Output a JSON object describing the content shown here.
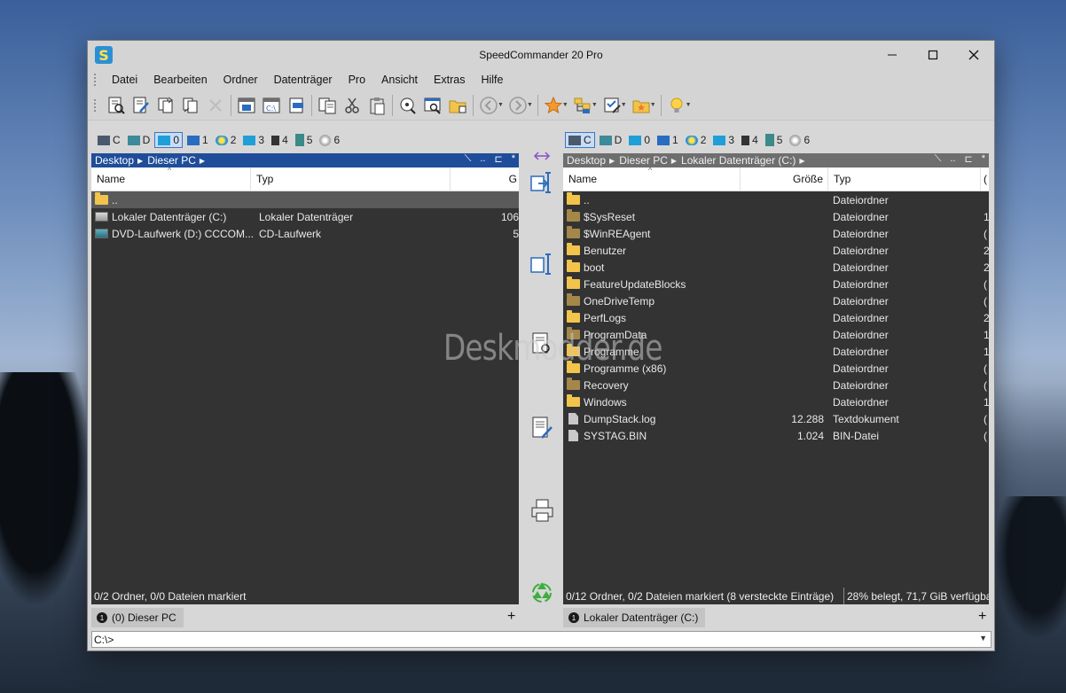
{
  "window": {
    "title": "SpeedCommander 20 Pro",
    "controls": {
      "minimize": "—",
      "maximize": "☐",
      "close": "✕"
    }
  },
  "menu": [
    "Datei",
    "Bearbeiten",
    "Ordner",
    "Datenträger",
    "Pro",
    "Ansicht",
    "Extras",
    "Hilfe"
  ],
  "drives": [
    {
      "label": "C",
      "icon": "computer-icon"
    },
    {
      "label": "D",
      "icon": "dvd-drive-icon"
    },
    {
      "label": "0",
      "icon": "monitor-icon"
    },
    {
      "label": "1",
      "icon": "network-icon"
    },
    {
      "label": "2",
      "icon": "internet-explorer-icon"
    },
    {
      "label": "3",
      "icon": "monitor-icon"
    },
    {
      "label": "4",
      "icon": "film-icon"
    },
    {
      "label": "5",
      "icon": "book-icon"
    },
    {
      "label": "6",
      "icon": "disc-icon"
    }
  ],
  "left_panel": {
    "path": [
      "Desktop",
      "Dieser PC"
    ],
    "path_tools": [
      "⟍",
      "..",
      "⊏",
      "*"
    ],
    "columns": {
      "name": "Name",
      "type": "Typ",
      "size": "G"
    },
    "rows": [
      {
        "name": "..",
        "type": "",
        "size": "",
        "kind": "folder",
        "selected": true
      },
      {
        "name": "Lokaler Datenträger (C:)",
        "type": "Lokaler Datenträger",
        "size": "106",
        "kind": "drive"
      },
      {
        "name": "DVD-Laufwerk (D:) CCCOM...",
        "type": "CD-Laufwerk",
        "size": "5",
        "kind": "dvd"
      }
    ],
    "status": "0/2 Ordner, 0/0 Dateien markiert",
    "tab": {
      "num": "1",
      "label": "(0) Dieser PC"
    }
  },
  "right_panel": {
    "path": [
      "Desktop",
      "Dieser PC",
      "Lokaler Datenträger (C:)"
    ],
    "path_tools": [
      "⟍",
      "..",
      "⊏",
      "*"
    ],
    "columns": {
      "name": "Name",
      "size": "Größe",
      "type": "Typ",
      "extra": "("
    },
    "rows": [
      {
        "name": "..",
        "size": "",
        "type": "Dateiordner",
        "extra": "",
        "kind": "folder"
      },
      {
        "name": "$SysReset",
        "size": "",
        "type": "Dateiordner",
        "extra": "1",
        "kind": "folder-dim"
      },
      {
        "name": "$WinREAgent",
        "size": "",
        "type": "Dateiordner",
        "extra": "(",
        "kind": "folder-dim"
      },
      {
        "name": "Benutzer",
        "size": "",
        "type": "Dateiordner",
        "extra": "2",
        "kind": "folder"
      },
      {
        "name": "boot",
        "size": "",
        "type": "Dateiordner",
        "extra": "2",
        "kind": "folder"
      },
      {
        "name": "FeatureUpdateBlocks",
        "size": "",
        "type": "Dateiordner",
        "extra": "(",
        "kind": "folder"
      },
      {
        "name": "OneDriveTemp",
        "size": "",
        "type": "Dateiordner",
        "extra": "(",
        "kind": "folder-dim"
      },
      {
        "name": "PerfLogs",
        "size": "",
        "type": "Dateiordner",
        "extra": "2",
        "kind": "folder"
      },
      {
        "name": "ProgramData",
        "size": "",
        "type": "Dateiordner",
        "extra": "1",
        "kind": "folder-dim"
      },
      {
        "name": "Programme",
        "size": "",
        "type": "Dateiordner",
        "extra": "1",
        "kind": "folder"
      },
      {
        "name": "Programme (x86)",
        "size": "",
        "type": "Dateiordner",
        "extra": "(",
        "kind": "folder"
      },
      {
        "name": "Recovery",
        "size": "",
        "type": "Dateiordner",
        "extra": "(",
        "kind": "folder-dim"
      },
      {
        "name": "Windows",
        "size": "",
        "type": "Dateiordner",
        "extra": "1",
        "kind": "folder"
      },
      {
        "name": "DumpStack.log",
        "size": "12.288",
        "type": "Textdokument",
        "extra": "(",
        "kind": "file"
      },
      {
        "name": "SYSTAG.BIN",
        "size": "1.024",
        "type": "BIN-Datei",
        "extra": "(",
        "kind": "file"
      }
    ],
    "status_left": "0/12 Ordner, 0/2 Dateien markiert (8 versteckte Einträge)",
    "status_right": "28% belegt, 71,7 GiB verfügbar",
    "tab": {
      "num": "1",
      "label": "Lokaler Datenträger (C:)"
    }
  },
  "plus_label": "+",
  "command_line": "C:\\>",
  "middle_buttons": [
    "swap-panels-icon",
    "copy-icon",
    "move-icon",
    "view-file-icon",
    "edit-file-icon",
    "print-icon",
    "recycle-icon"
  ],
  "watermark": "Deskmodder.de",
  "colors": {
    "accent": "#1f4d9a",
    "panel_bg": "#333333",
    "folder": "#f2c44b"
  }
}
